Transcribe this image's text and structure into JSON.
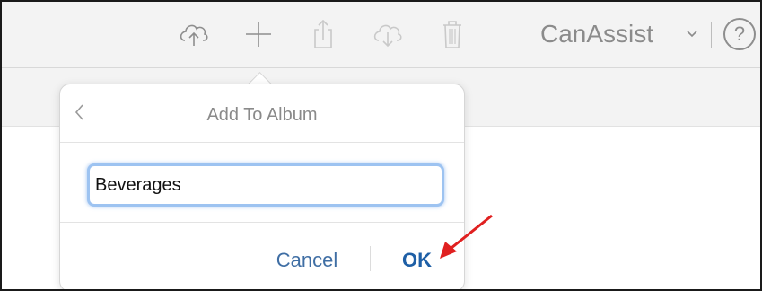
{
  "toolbar": {
    "account_name": "CanAssist",
    "help_label": "?",
    "icons": [
      "upload-cloud-icon",
      "plus-icon",
      "share-icon",
      "download-cloud-icon",
      "trash-icon",
      "chevron-down-icon"
    ]
  },
  "dialog": {
    "title": "Add To Album",
    "input_value": "Beverages",
    "cancel_label": "Cancel",
    "ok_label": "OK"
  },
  "colors": {
    "accent": "#1e5fa6",
    "annotation_arrow": "#e02020"
  }
}
